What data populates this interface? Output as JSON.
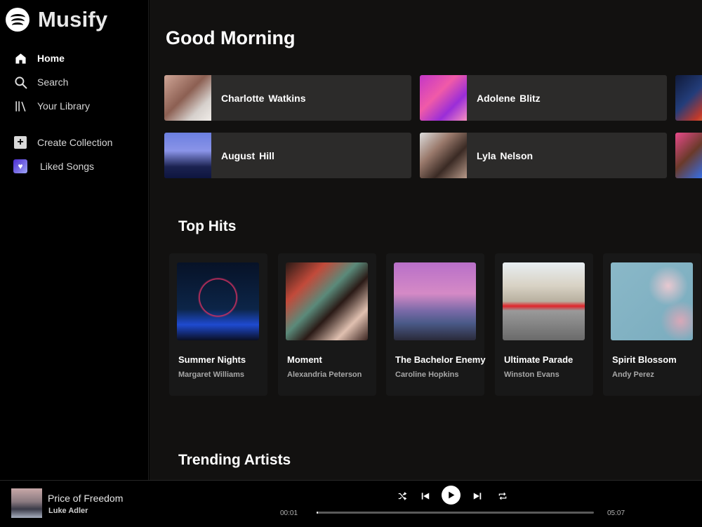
{
  "brand": {
    "name": "Musify",
    "icon": "spotify-logo"
  },
  "sidebar": {
    "items": [
      {
        "label": "Home",
        "icon": "home-icon",
        "active": true
      },
      {
        "label": "Search",
        "icon": "search-icon",
        "active": false
      },
      {
        "label": "Your Library",
        "icon": "library-icon",
        "active": false
      }
    ],
    "actions": [
      {
        "label": "Create Collection",
        "icon": "plus-icon"
      },
      {
        "label": "Liked Songs",
        "icon": "heart-icon"
      }
    ]
  },
  "main": {
    "greeting": "Good Morning",
    "quick_picks": [
      {
        "name": "Charlotte  Watkins"
      },
      {
        "name": "Adolene  Blitz"
      },
      {
        "name": "August  Hill"
      },
      {
        "name": "Lyla  Nelson"
      }
    ],
    "top_hits_title": "Top Hits",
    "top_hits": [
      {
        "title": "Summer Nights",
        "artist": "Margaret Williams"
      },
      {
        "title": "Moment",
        "artist": "Alexandria Peterson"
      },
      {
        "title": "The Bachelor Enemy",
        "artist": "Caroline Hopkins"
      },
      {
        "title": "Ultimate Parade",
        "artist": "Winston Evans"
      },
      {
        "title": "Spirit Blossom",
        "artist": "Andy Perez"
      }
    ],
    "trending_title": "Trending Artists"
  },
  "player": {
    "track_title": "Price of Freedom",
    "track_artist": "Luke Adler",
    "elapsed": "00:01",
    "duration": "05:07",
    "progress": 0.003,
    "controls": [
      "shuffle-icon",
      "previous-icon",
      "play-icon",
      "next-icon",
      "repeat-icon"
    ]
  },
  "colors": {
    "background": "#121110",
    "sidebar": "#000000",
    "card": "#2c2b2a",
    "hit_card": "#181818"
  }
}
